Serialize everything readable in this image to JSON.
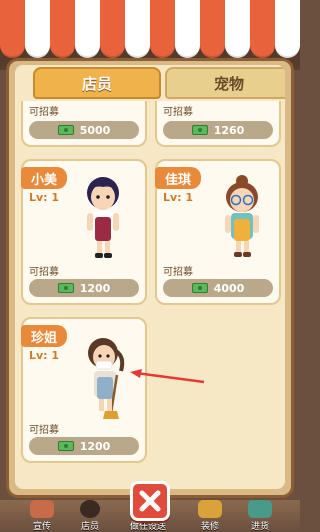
{
  "tabs": {
    "staff": "店员",
    "pets": "宠物"
  },
  "top_cards": [
    {
      "recruit_label": "可招募",
      "price": "5000"
    },
    {
      "recruit_label": "可招募",
      "price": "1260"
    }
  ],
  "cards": [
    {
      "name": "小美",
      "level": "Lv: 1",
      "recruit_label": "可招募",
      "price": "1200"
    },
    {
      "name": "佳琪",
      "level": "Lv: 1",
      "recruit_label": "可招募",
      "price": "4000"
    },
    {
      "name": "珍姐",
      "level": "Lv: 1",
      "recruit_label": "可招募",
      "price": "1200"
    }
  ],
  "bottom_nav": {
    "promote": "宣传",
    "staff": "店员",
    "hidden": "做任设送",
    "decorate": "装修",
    "restock": "进货"
  },
  "colors": {
    "accent": "#e9893a",
    "close": "#e14b3b",
    "arrow": "#e53935"
  },
  "icons": [
    "money-icon",
    "close-icon",
    "arrow-icon"
  ]
}
